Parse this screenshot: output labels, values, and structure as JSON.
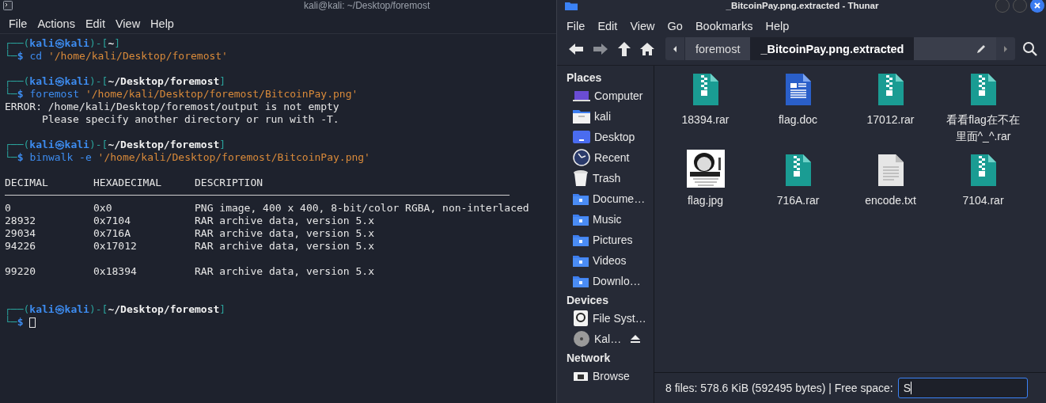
{
  "terminal": {
    "title": "kali@kali: ~/Desktop/foremost",
    "menu": [
      "File",
      "Actions",
      "Edit",
      "View",
      "Help"
    ],
    "blocks": [
      {
        "kind": "prompt",
        "corner": "┌──(",
        "user": "kali㉿kali",
        "sep": ")-[",
        "path": "~",
        "close": "]",
        "lead": "└─",
        "sign": "$",
        "command": "cd",
        "argument": "'/home/kali/Desktop/foremost'",
        "cursor": false
      },
      {
        "kind": "blank"
      },
      {
        "kind": "prompt",
        "corner": "┌──(",
        "user": "kali㉿kali",
        "sep": ")-[",
        "path": "~/Desktop/foremost",
        "close": "]",
        "lead": "└─",
        "sign": "$",
        "command": "foremost",
        "argument": "'/home/kali/Desktop/foremost/BitcoinPay.png'",
        "cursor": false
      },
      {
        "kind": "output",
        "text": "ERROR: /home/kali/Desktop/foremost/output is not empty"
      },
      {
        "kind": "output",
        "text": "      Please specify another directory or run with -T."
      },
      {
        "kind": "blank"
      },
      {
        "kind": "prompt",
        "corner": "┌──(",
        "user": "kali㉿kali",
        "sep": ")-[",
        "path": "~/Desktop/foremost",
        "close": "]",
        "lead": "└─",
        "sign": "$",
        "command": "binwalk -e",
        "argument": "'/home/kali/Desktop/foremost/BitcoinPay.png'",
        "cursor": false
      },
      {
        "kind": "blank"
      },
      {
        "kind": "table",
        "columns": [
          "DECIMAL",
          "HEXADECIMAL",
          "DESCRIPTION"
        ],
        "row_groups": [
          [
            [
              "0",
              "0x0",
              "PNG image, 400 x 400, 8-bit/color RGBA, non-interlaced"
            ],
            [
              "28932",
              "0x7104",
              "RAR archive data, version 5.x"
            ],
            [
              "29034",
              "0x716A",
              "RAR archive data, version 5.x"
            ],
            [
              "94226",
              "0x17012",
              "RAR archive data, version 5.x"
            ]
          ],
          [
            [
              "99220",
              "0x18394",
              "RAR archive data, version 5.x"
            ]
          ]
        ]
      },
      {
        "kind": "blank"
      },
      {
        "kind": "blank"
      },
      {
        "kind": "prompt",
        "corner": "┌──(",
        "user": "kali㉿kali",
        "sep": ")-[",
        "path": "~/Desktop/foremost",
        "close": "]",
        "lead": "└─",
        "sign": "$",
        "cursor": true
      }
    ]
  },
  "file_manager": {
    "title": "_BitcoinPay.png.extracted - Thunar",
    "menu": [
      "File",
      "Edit",
      "View",
      "Go",
      "Bookmarks",
      "Help"
    ],
    "path_bar": [
      {
        "label": "foremost",
        "selected": false
      },
      {
        "label": "_BitcoinPay.png.extracted",
        "selected": true
      }
    ],
    "sidebar": [
      {
        "heading": "Places",
        "items": [
          {
            "label": "Computer",
            "kind": "computer"
          },
          {
            "label": "kali",
            "kind": "home"
          },
          {
            "label": "Desktop",
            "kind": "desktop"
          },
          {
            "label": "Recent",
            "kind": "recent"
          },
          {
            "label": "Trash",
            "kind": "trash"
          },
          {
            "label": "Docume…",
            "kind": "documents"
          },
          {
            "label": "Music",
            "kind": "music"
          },
          {
            "label": "Pictures",
            "kind": "pictures"
          },
          {
            "label": "Videos",
            "kind": "videos"
          },
          {
            "label": "Downlo…",
            "kind": "downloads"
          }
        ]
      },
      {
        "heading": "Devices",
        "items": [
          {
            "label": "File Syst…",
            "kind": "drive"
          },
          {
            "label": "Kal…",
            "kind": "disc"
          }
        ]
      },
      {
        "heading": "Network",
        "items": [
          {
            "label": "Browse",
            "kind": "network"
          }
        ]
      }
    ],
    "files": [
      {
        "name": "18394.rar",
        "kind": "archive"
      },
      {
        "name": "flag.doc",
        "kind": "document"
      },
      {
        "name": "17012.rar",
        "kind": "archive"
      },
      {
        "name": "看看flag在不在里面^_^.rar",
        "kind": "archive"
      },
      {
        "name": "flag.jpg",
        "kind": "picture"
      },
      {
        "name": "716A.rar",
        "kind": "archive"
      },
      {
        "name": "encode.txt",
        "kind": "text"
      },
      {
        "name": "7104.rar",
        "kind": "archive"
      }
    ],
    "status_bar": {
      "text": "8 files: 578.6 KiB (592495 bytes) | Free space:",
      "field_value": "S"
    }
  }
}
